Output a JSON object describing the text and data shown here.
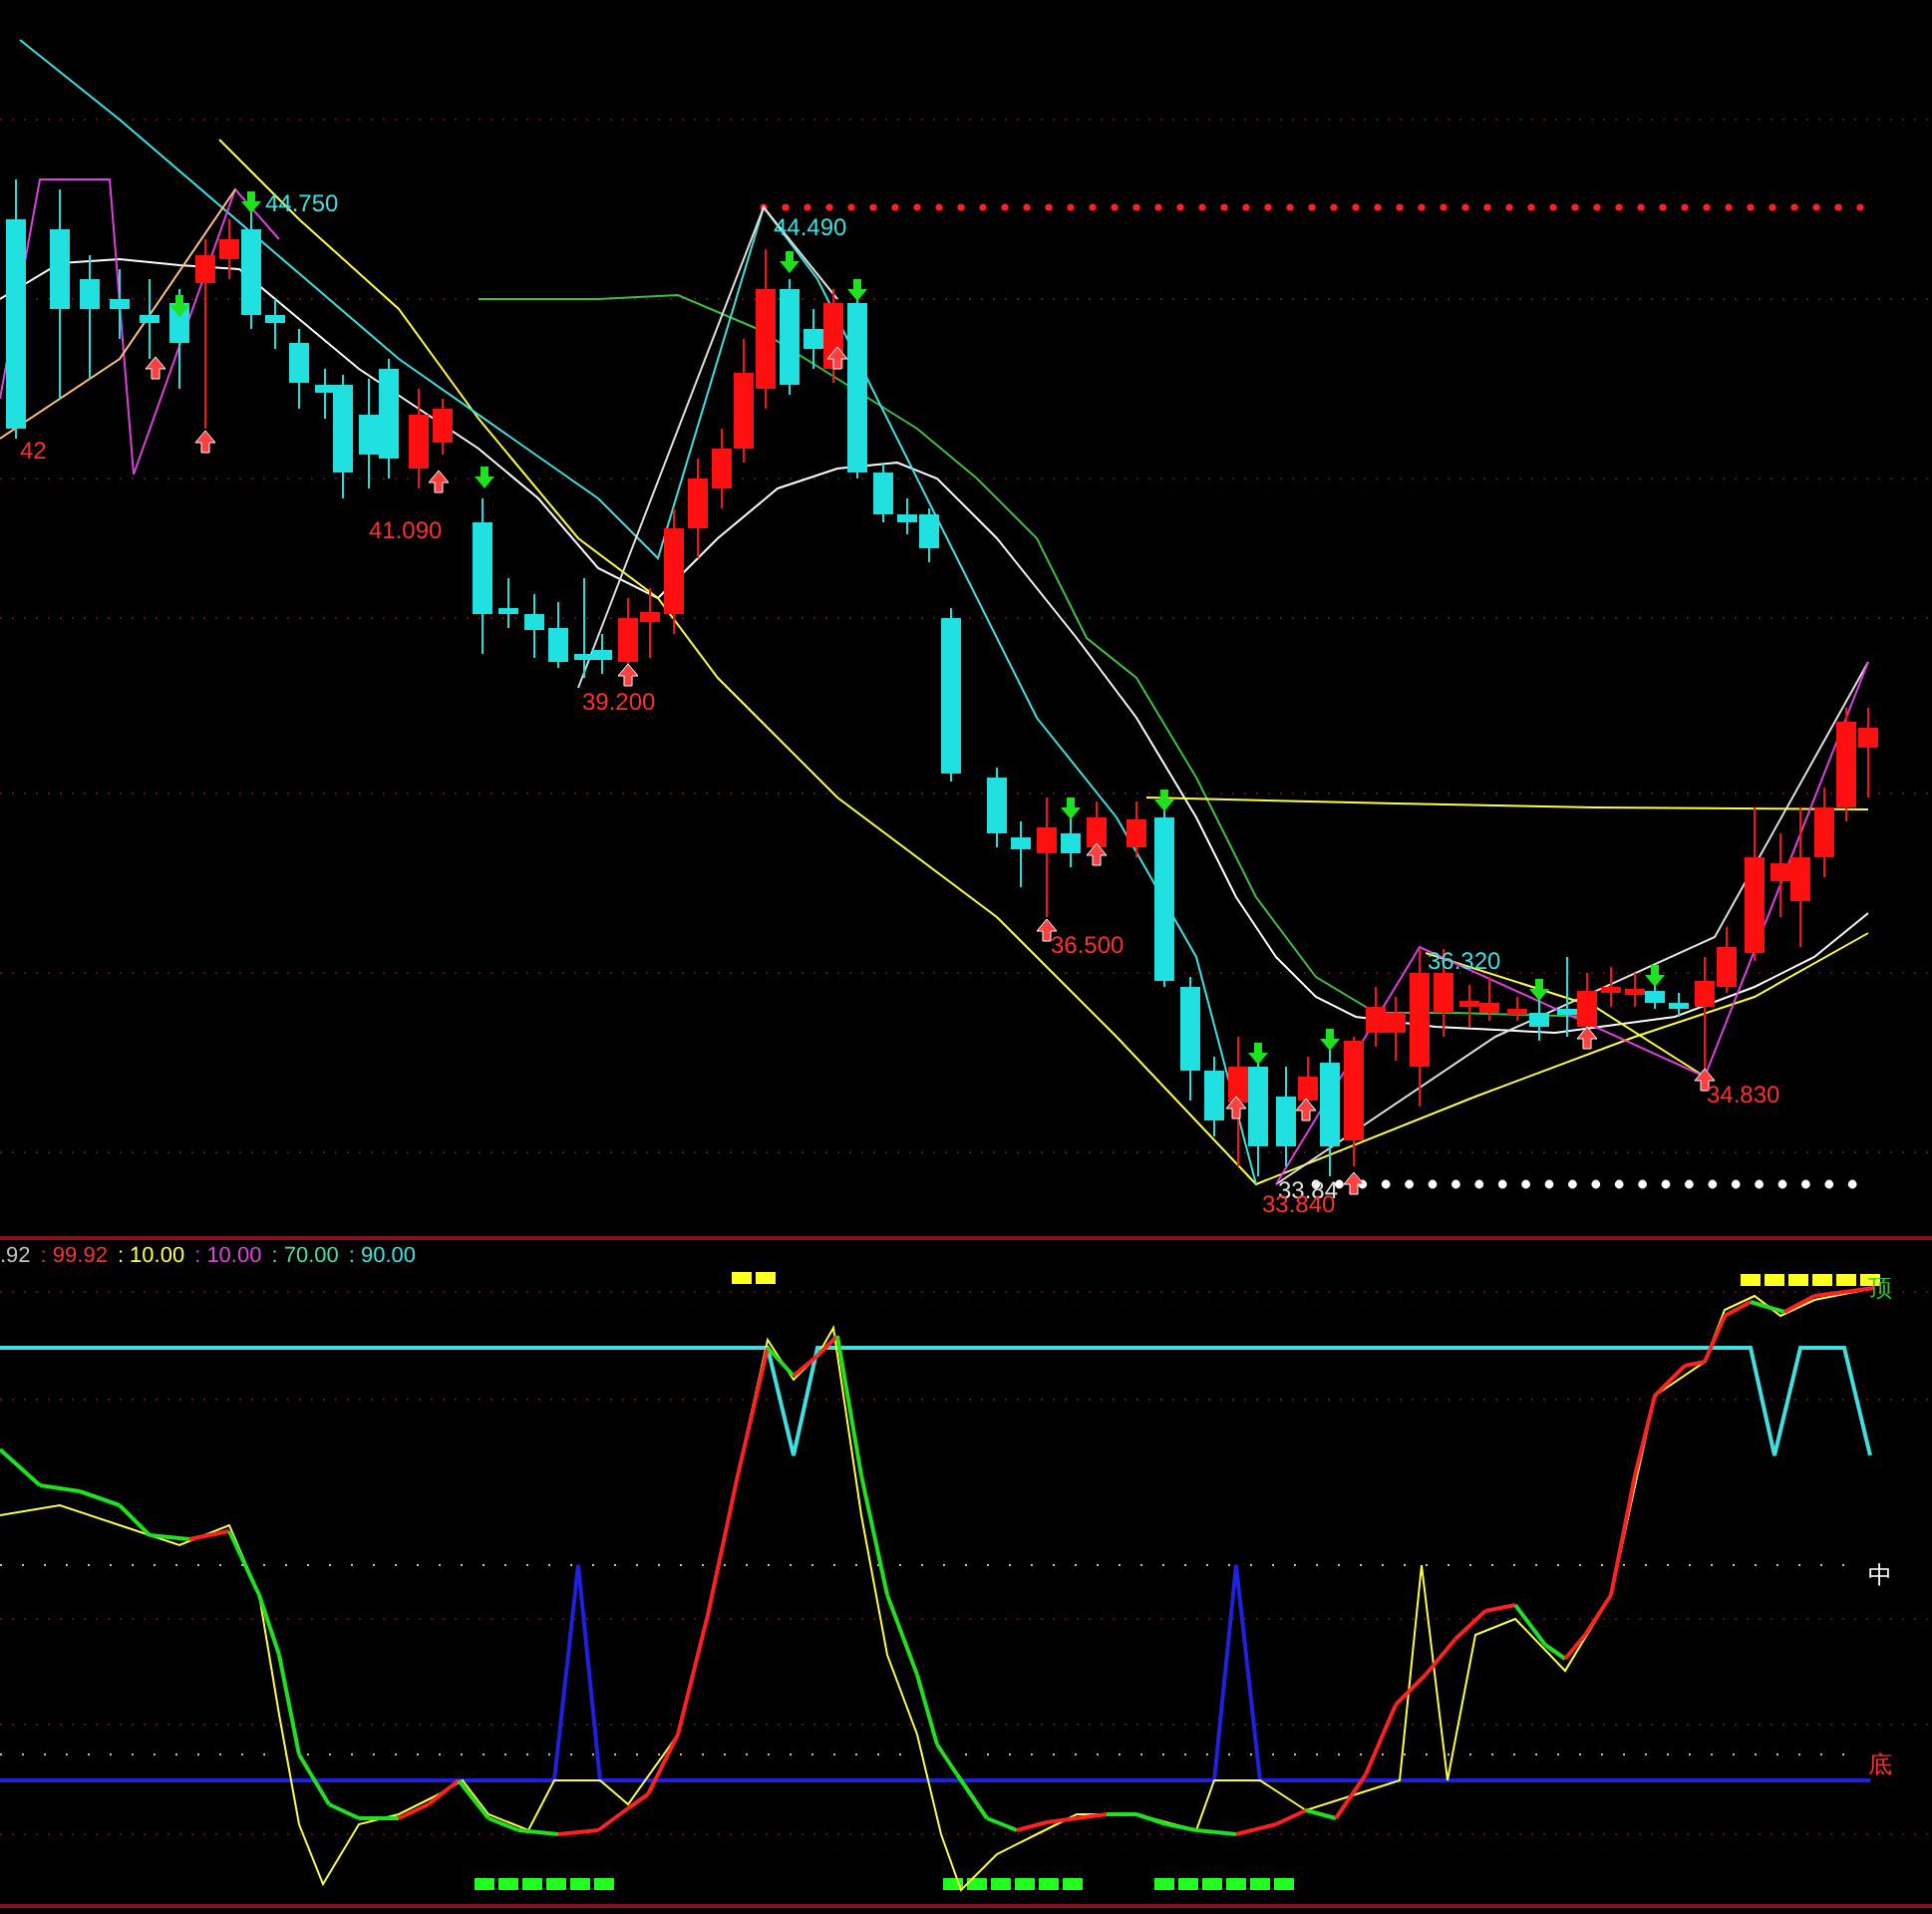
{
  "price_chart": {
    "labels": [
      {
        "text": "44.750",
        "color": "#40e0e0"
      },
      {
        "text": "44.490",
        "color": "#40e0e0"
      },
      {
        "text": "42",
        "color": "#ff3030"
      },
      {
        "text": "41.090",
        "color": "#ff3030"
      },
      {
        "text": "39.200",
        "color": "#ff3030"
      },
      {
        "text": "36.500",
        "color": "#ff3030"
      },
      {
        "text": "36.320",
        "color": "#40e0e0"
      },
      {
        "text": "34.830",
        "color": "#ff3030"
      },
      {
        "text": "33.84",
        "color": "#e0e0e0"
      },
      {
        "text": "33.840",
        "color": "#ff3030"
      }
    ]
  },
  "indicator_panel": {
    "values": [
      {
        "text": ".92",
        "color": "#c0c0c0"
      },
      {
        "text": ": 99.92",
        "color": "#ff3030"
      },
      {
        "text": ": 10.00",
        "color": "#ffff40"
      },
      {
        "text": ": 10.00",
        "color": "#e040e0"
      },
      {
        "text": ": 70.00",
        "color": "#40e0a0"
      },
      {
        "text": ": 90.00",
        "color": "#40e0e0"
      }
    ],
    "zone_labels": [
      {
        "text": "顶",
        "color": "#30c030"
      },
      {
        "text": "中",
        "color": "#ffffff"
      },
      {
        "text": "底",
        "color": "#ff3030"
      }
    ]
  }
}
